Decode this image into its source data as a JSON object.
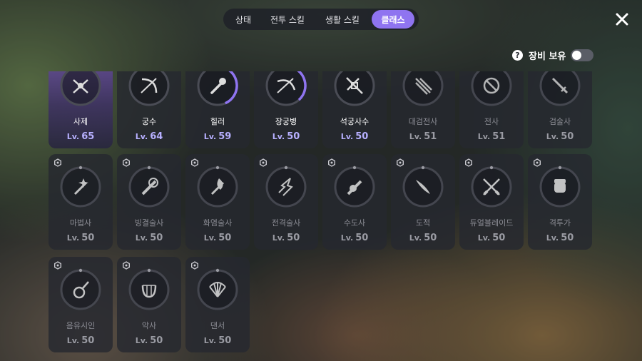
{
  "tabs": [
    "상태",
    "전투 스킬",
    "생활 스킬",
    "클래스"
  ],
  "active_tab": "클래스",
  "equip_toggle": {
    "label": "장비 보유",
    "help_symbol": "?",
    "on": false
  },
  "level_prefix": "Lv.",
  "classes": [
    {
      "name": "사제",
      "level": "65",
      "progress": 0,
      "active": true,
      "icon": "cleric-icon"
    },
    {
      "name": "궁수",
      "level": "64",
      "progress": 0,
      "active": true,
      "icon": "archer-icon"
    },
    {
      "name": "힐러",
      "level": "59",
      "progress": 0.35,
      "active": true,
      "icon": "healer-icon"
    },
    {
      "name": "장궁병",
      "level": "50",
      "progress": 0.3,
      "active": true,
      "icon": "longbowman-icon"
    },
    {
      "name": "석궁사수",
      "level": "50",
      "progress": 0,
      "active": true,
      "icon": "crossbowman-icon"
    },
    {
      "name": "대검전사",
      "level": "51",
      "progress": 0,
      "active": false,
      "icon": "greatsword-warrior-icon"
    },
    {
      "name": "전사",
      "level": "51",
      "progress": 0,
      "active": false,
      "icon": "warrior-icon"
    },
    {
      "name": "검술사",
      "level": "50",
      "progress": 0,
      "active": false,
      "icon": "swordsman-icon"
    },
    {
      "name": "마법사",
      "level": "50",
      "progress": 0,
      "active": false,
      "icon": "mage-icon"
    },
    {
      "name": "빙결술사",
      "level": "50",
      "progress": 0,
      "active": false,
      "icon": "ice-mage-icon"
    },
    {
      "name": "화염술사",
      "level": "50",
      "progress": 0,
      "active": false,
      "icon": "fire-mage-icon"
    },
    {
      "name": "전격술사",
      "level": "50",
      "progress": 0,
      "active": false,
      "icon": "lightning-mage-icon"
    },
    {
      "name": "수도사",
      "level": "50",
      "progress": 0,
      "active": false,
      "icon": "monk-icon"
    },
    {
      "name": "도적",
      "level": "50",
      "progress": 0,
      "active": false,
      "icon": "rogue-icon"
    },
    {
      "name": "듀얼블레이드",
      "level": "50",
      "progress": 0,
      "active": false,
      "icon": "dual-blade-icon"
    },
    {
      "name": "격투가",
      "level": "50",
      "progress": 0,
      "active": false,
      "icon": "fighter-icon"
    },
    {
      "name": "음유시인",
      "level": "50",
      "progress": 0,
      "active": false,
      "icon": "bard-icon"
    },
    {
      "name": "악사",
      "level": "50",
      "progress": 0,
      "active": false,
      "icon": "musician-icon"
    },
    {
      "name": "댄서",
      "level": "50",
      "progress": 0,
      "active": false,
      "icon": "dancer-icon"
    }
  ],
  "colors": {
    "accent": "#8f74f0",
    "level_active": "#b7b0ff",
    "level_dim": "#9a9ba3"
  }
}
